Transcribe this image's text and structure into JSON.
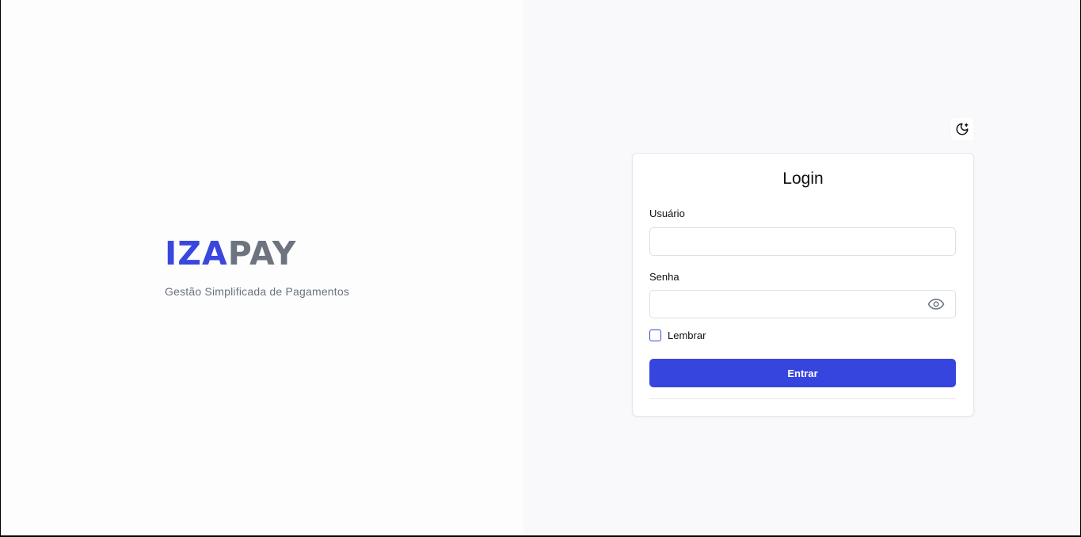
{
  "brand": {
    "logo_part1": "IZA",
    "logo_part2": "PAY",
    "tagline": "Gestão Simplificada de Pagamentos"
  },
  "theme_toggle": {
    "icon": "moon-sparkle-icon"
  },
  "login": {
    "title": "Login",
    "username_label": "Usuário",
    "username_value": "",
    "password_label": "Senha",
    "password_value": "",
    "password_toggle_icon": "eye-icon",
    "remember_label": "Lembrar",
    "remember_checked": false,
    "submit_label": "Entrar"
  },
  "colors": {
    "accent": "#3745df",
    "logo_secondary": "#6d7480",
    "right_bg": "#f9f9fb"
  }
}
